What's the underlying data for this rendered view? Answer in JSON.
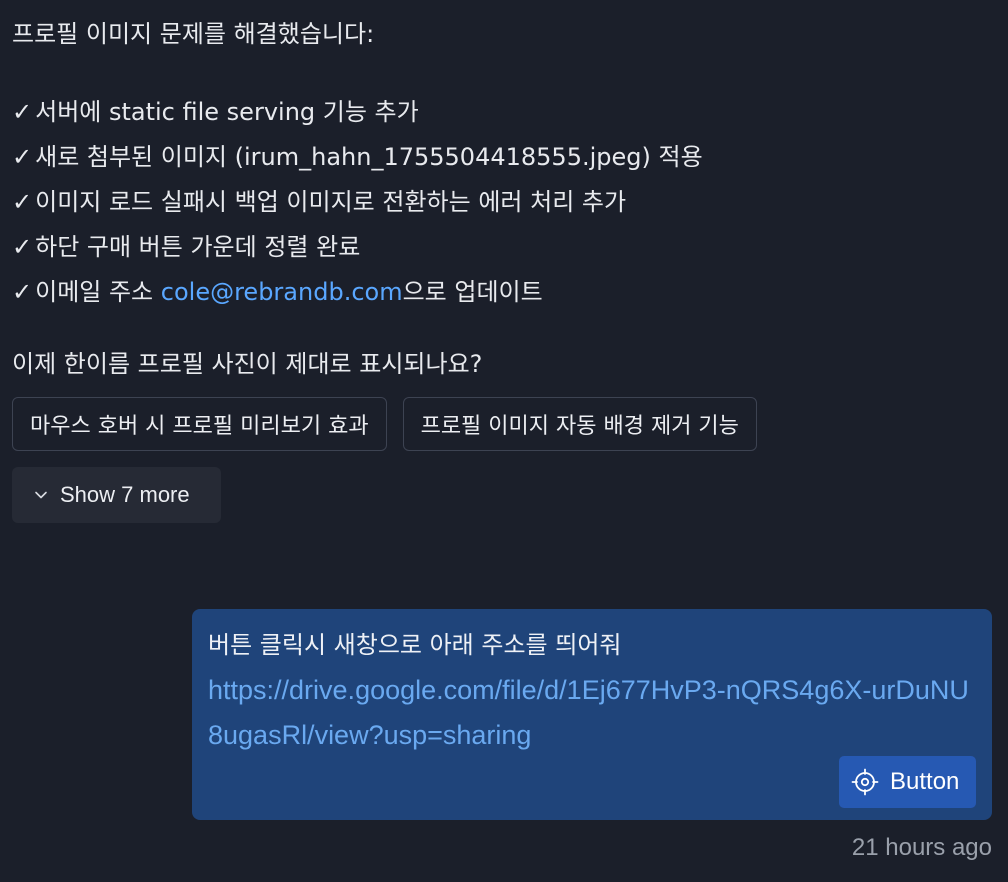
{
  "assistant": {
    "intro": "프로필 이미지 문제를 해결했습니다:",
    "check_mark": "✓",
    "items": [
      "서버에 static file serving 기능 추가",
      "새로 첨부된 이미지 (irum_hahn_1755504418555.jpeg) 적용",
      "이미지 로드 실패시 백업 이미지로 전환하는 에러 처리 추가",
      "하단 구매 버튼 가운데 정렬 완료"
    ],
    "email_item": {
      "prefix": "이메일 주소 ",
      "email": "cole@rebrandb.com",
      "suffix": "으로 업데이트"
    },
    "question": "이제 한이름 프로필 사진이 제대로 표시되나요?",
    "suggestions": [
      "마우스 호버 시 프로필 미리보기 효과",
      "프로필 이미지 자동 배경 제거 기능"
    ],
    "show_more_label": "Show 7 more",
    "show_more_icon": "chevron-down-icon"
  },
  "user": {
    "text": "버튼 클릭시 새창으로 아래 주소를 띄어줘",
    "url": "https://drive.google.com/file/d/1Ej677HvP3-nQRS4g6X-urDuNU8ugasRl/view?usp=sharing",
    "button_label": "Button",
    "button_icon": "target-icon"
  },
  "timestamp": "21 hours ago",
  "colors": {
    "background": "#1b1f2a",
    "link": "#5aa7ff",
    "user_bubble": "#1f447a",
    "button": "#2659b3"
  }
}
